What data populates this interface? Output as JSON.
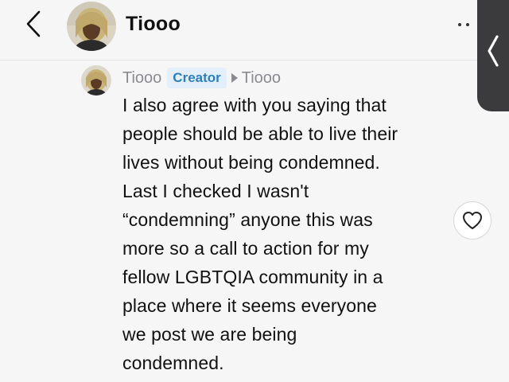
{
  "header": {
    "title": "Tiooo",
    "back_icon": "chevron-left-icon",
    "more_icon": "more-dots-icon",
    "avatar_icon": "user-avatar"
  },
  "side_tab": {
    "icon": "chevron-left-icon"
  },
  "comment": {
    "author": "Tiooo",
    "badge": "Creator",
    "reply_to": "Tiooo",
    "text": " I also agree with you saying that\npeople should be able to live their\nlives without being condemned.\nLast I checked I wasn't\n“condemning” anyone this was\nmore so a call to action for my\nfellow LGBTQIA community in a\nplace where it seems everyone\nwe post we are being\ncondemned.",
    "like_icon": "heart-icon"
  },
  "colors": {
    "background": "#f6f6f7",
    "badge_bg": "#e3f0fb",
    "badge_text": "#2c7fbd",
    "meta_text": "#8a8a90",
    "side_tab": "#3b3b3d"
  }
}
